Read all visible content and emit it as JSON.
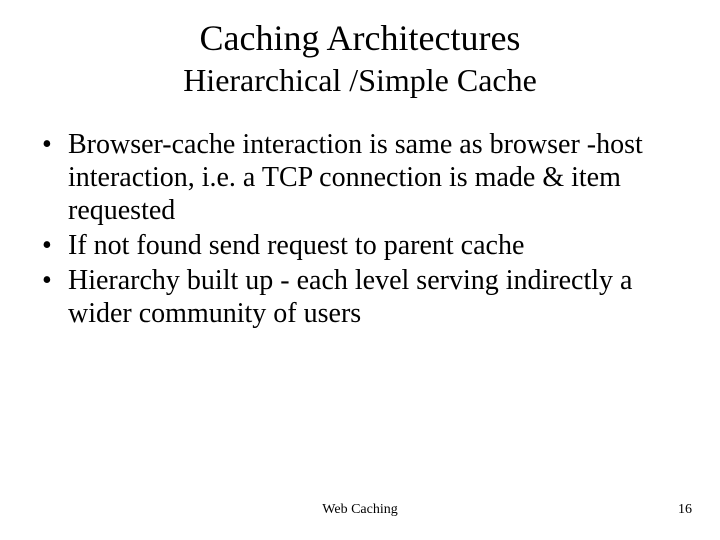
{
  "title": "Caching Architectures",
  "subtitle": "Hierarchical /Simple Cache",
  "bullets": [
    "Browser-cache  interaction is same as browser -host interaction, i.e. a TCP connection is made & item requested",
    "If not found send request to parent cache",
    "Hierarchy built up - each level serving indirectly a wider community of users"
  ],
  "footer": {
    "center": "Web  Caching",
    "page": "16"
  }
}
